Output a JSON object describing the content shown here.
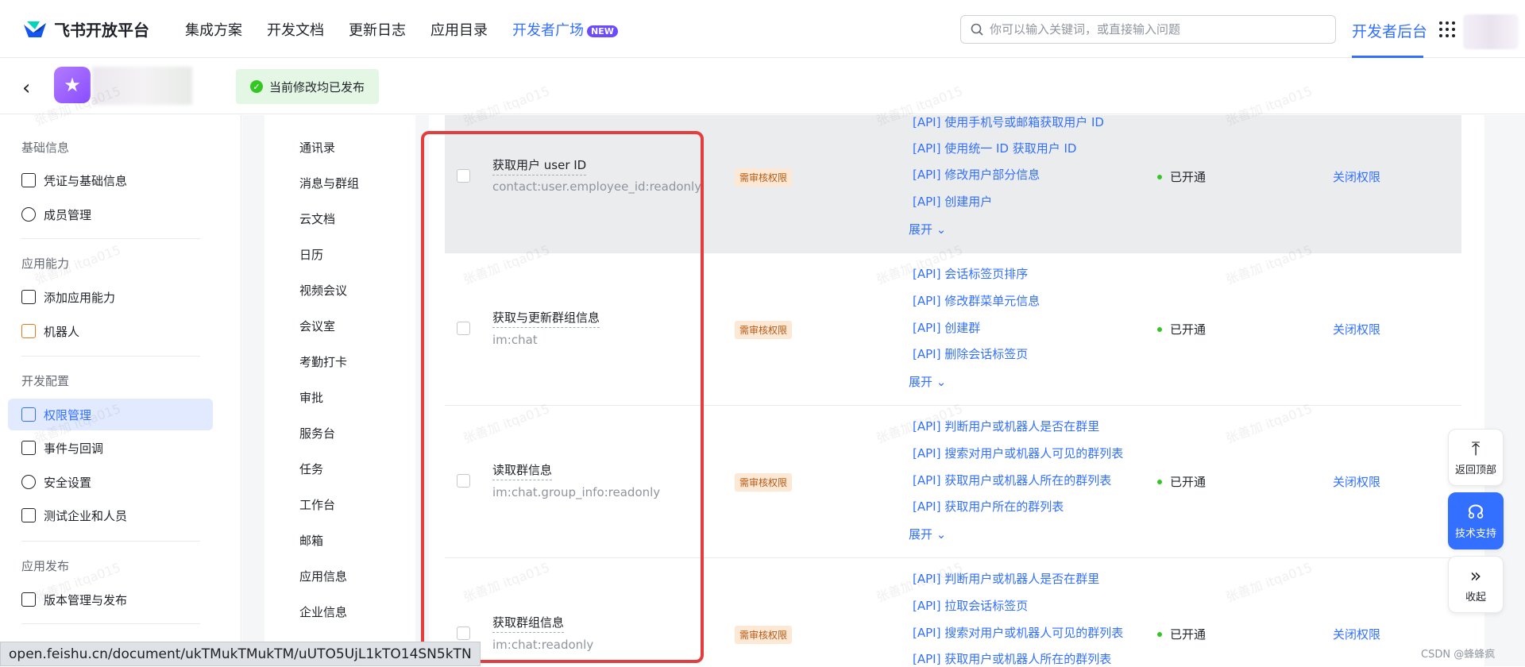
{
  "topbar": {
    "brand": "飞书开放平台",
    "nav": [
      {
        "label": "集成方案"
      },
      {
        "label": "开发文档"
      },
      {
        "label": "更新日志"
      },
      {
        "label": "应用目录"
      },
      {
        "label": "开发者广场",
        "badge": "NEW"
      }
    ],
    "search_placeholder": "你可以输入关键词，或直接输入问题",
    "console_label": "开发者后台"
  },
  "subbar": {
    "status_text": "当前修改均已发布"
  },
  "sidebar": {
    "sections": [
      {
        "title": "基础信息",
        "items": [
          "凭证与基础信息",
          "成员管理"
        ]
      },
      {
        "title": "应用能力",
        "items": [
          "添加应用能力",
          "机器人"
        ]
      },
      {
        "title": "开发配置",
        "items": [
          "权限管理",
          "事件与回调",
          "安全设置",
          "测试企业和人员"
        ]
      },
      {
        "title": "应用发布",
        "items": [
          "版本管理与发布"
        ]
      }
    ],
    "active_item": "权限管理"
  },
  "categories": [
    "通讯录",
    "消息与群组",
    "云文档",
    "日历",
    "视频会议",
    "会议室",
    "考勤打卡",
    "审批",
    "服务台",
    "任务",
    "工作台",
    "邮箱",
    "应用信息",
    "企业信息"
  ],
  "permissions": [
    {
      "name": "获取用户 user ID",
      "code": "contact:user.employee_id:readonly",
      "tag": "需审核权限",
      "apis": [
        "[API] 使用手机号或邮箱获取用户 ID",
        "[API] 使用统一 ID 获取用户 ID",
        "[API] 修改用户部分信息",
        "[API] 创建用户"
      ],
      "expand": "展开",
      "status": "已开通",
      "action": "关闭权限"
    },
    {
      "name": "获取与更新群组信息",
      "code": "im:chat",
      "tag": "需审核权限",
      "apis": [
        "[API] 会话标签页排序",
        "[API] 修改群菜单元信息",
        "[API] 创建群",
        "[API] 删除会话标签页"
      ],
      "expand": "展开",
      "status": "已开通",
      "action": "关闭权限"
    },
    {
      "name": "读取群信息",
      "code": "im:chat.group_info:readonly",
      "tag": "需审核权限",
      "apis": [
        "[API] 判断用户或机器人是否在群里",
        "[API] 搜索对用户或机器人可见的群列表",
        "[API] 获取用户或机器人所在的群列表",
        "[API] 获取用户所在的群列表"
      ],
      "expand": "展开",
      "status": "已开通",
      "action": "关闭权限"
    },
    {
      "name": "获取群组信息",
      "code": "im:chat:readonly",
      "tag": "需审核权限",
      "apis": [
        "[API] 判断用户或机器人是否在群里",
        "[API] 拉取会话标签页",
        "[API] 搜索对用户或机器人可见的群列表",
        "[API] 获取用户或机器人所在的群列表"
      ],
      "expand": "",
      "status": "已开通",
      "action": "关闭权限"
    }
  ],
  "float_buttons": {
    "top": "返回顶部",
    "support": "技术支持",
    "collapse": "收起"
  },
  "status_url": "open.feishu.cn/document/ukTMukTMukTM/uUTO5UjL1kTO14SN5kTN",
  "csdn_mark": "CSDN @蜂蜂疯",
  "watermark": "张善加 itqa015",
  "colors": {
    "accent": "#3370ff",
    "highlight": "#e43d3d",
    "success": "#34c724"
  }
}
